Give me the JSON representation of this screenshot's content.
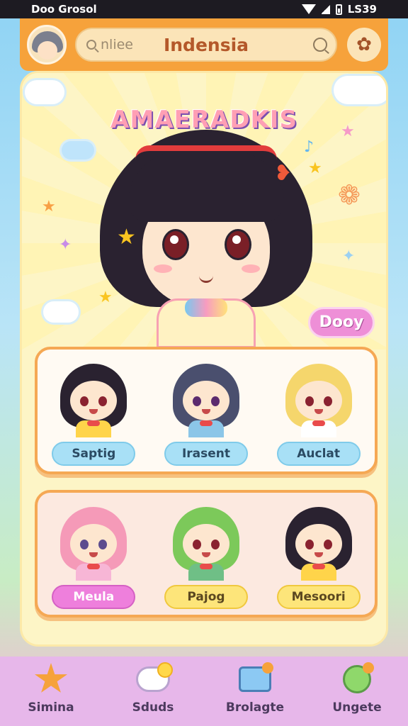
{
  "status_bar": {
    "left_text": "Doo Grosol",
    "time": "LS39"
  },
  "header": {
    "search_placeholder": "nliee",
    "title": "Indensia"
  },
  "hero": {
    "title": "AMAERADKIS",
    "action_label": "Dooy"
  },
  "characters": [
    {
      "name": "Saptig",
      "hair_color": "#2a2230",
      "body_color": "#ffd44a",
      "eye_color": "#8a2230",
      "pill": "blue"
    },
    {
      "name": "Irasent",
      "hair_color": "#4a4f6e",
      "body_color": "#8cc6e8",
      "eye_color": "#5b2a6e",
      "pill": "blue"
    },
    {
      "name": "Auclat",
      "hair_color": "#f5d66c",
      "body_color": "#ffffff",
      "eye_color": "#8a2230",
      "pill": "blue"
    },
    {
      "name": "Meula",
      "hair_color": "#f59ab8",
      "body_color": "#f7b6d6",
      "eye_color": "#5c4b8e",
      "pill": "pink"
    },
    {
      "name": "Pajog",
      "hair_color": "#7cc95a",
      "body_color": "#6fbf86",
      "eye_color": "#8a2230",
      "pill": "yellow"
    },
    {
      "name": "Mesoori",
      "hair_color": "#2a2230",
      "body_color": "#ffd44a",
      "eye_color": "#8a2230",
      "pill": "yellow"
    }
  ],
  "bottom_nav": [
    {
      "label": "Simina",
      "icon": "star-face-icon"
    },
    {
      "label": "Sduds",
      "icon": "chat-icon"
    },
    {
      "label": "Brolagte",
      "icon": "board-icon"
    },
    {
      "label": "Ungete",
      "icon": "gem-icon"
    }
  ],
  "colors": {
    "header_orange": "#f6a23b",
    "panel_cream": "#fdf5c6",
    "nav_lilac": "#e7b7ea"
  }
}
